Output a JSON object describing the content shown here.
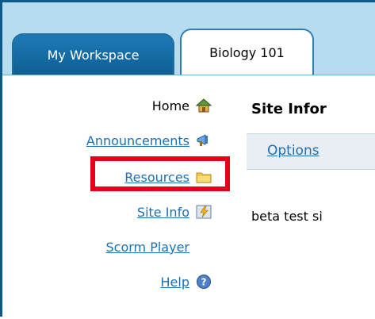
{
  "tabs": [
    {
      "label": "My Workspace",
      "active": false
    },
    {
      "label": "Biology 101",
      "active": true
    }
  ],
  "nav": {
    "items": [
      {
        "label": "Home",
        "icon": "home-icon",
        "link": false
      },
      {
        "label": "Announcements",
        "icon": "megaphone-icon",
        "link": true
      },
      {
        "label": "Resources",
        "icon": "folder-icon",
        "link": true,
        "highlighted": true
      },
      {
        "label": "Site Info",
        "icon": "site-info-icon",
        "link": true
      },
      {
        "label": "Scorm Player",
        "icon": "",
        "link": true
      },
      {
        "label": "Help",
        "icon": "help-icon",
        "link": true
      }
    ]
  },
  "content": {
    "title": "Site Infor",
    "options_label": "Options",
    "description": "beta test si"
  },
  "colors": {
    "accent": "#1e6fb3",
    "tab_active_bg": "#ffffff",
    "tab_inactive_bg": "#1d7ab7",
    "tabbar_bg": "#b7dbef",
    "highlight": "#e4001b",
    "frame": "#0b5a8a"
  }
}
